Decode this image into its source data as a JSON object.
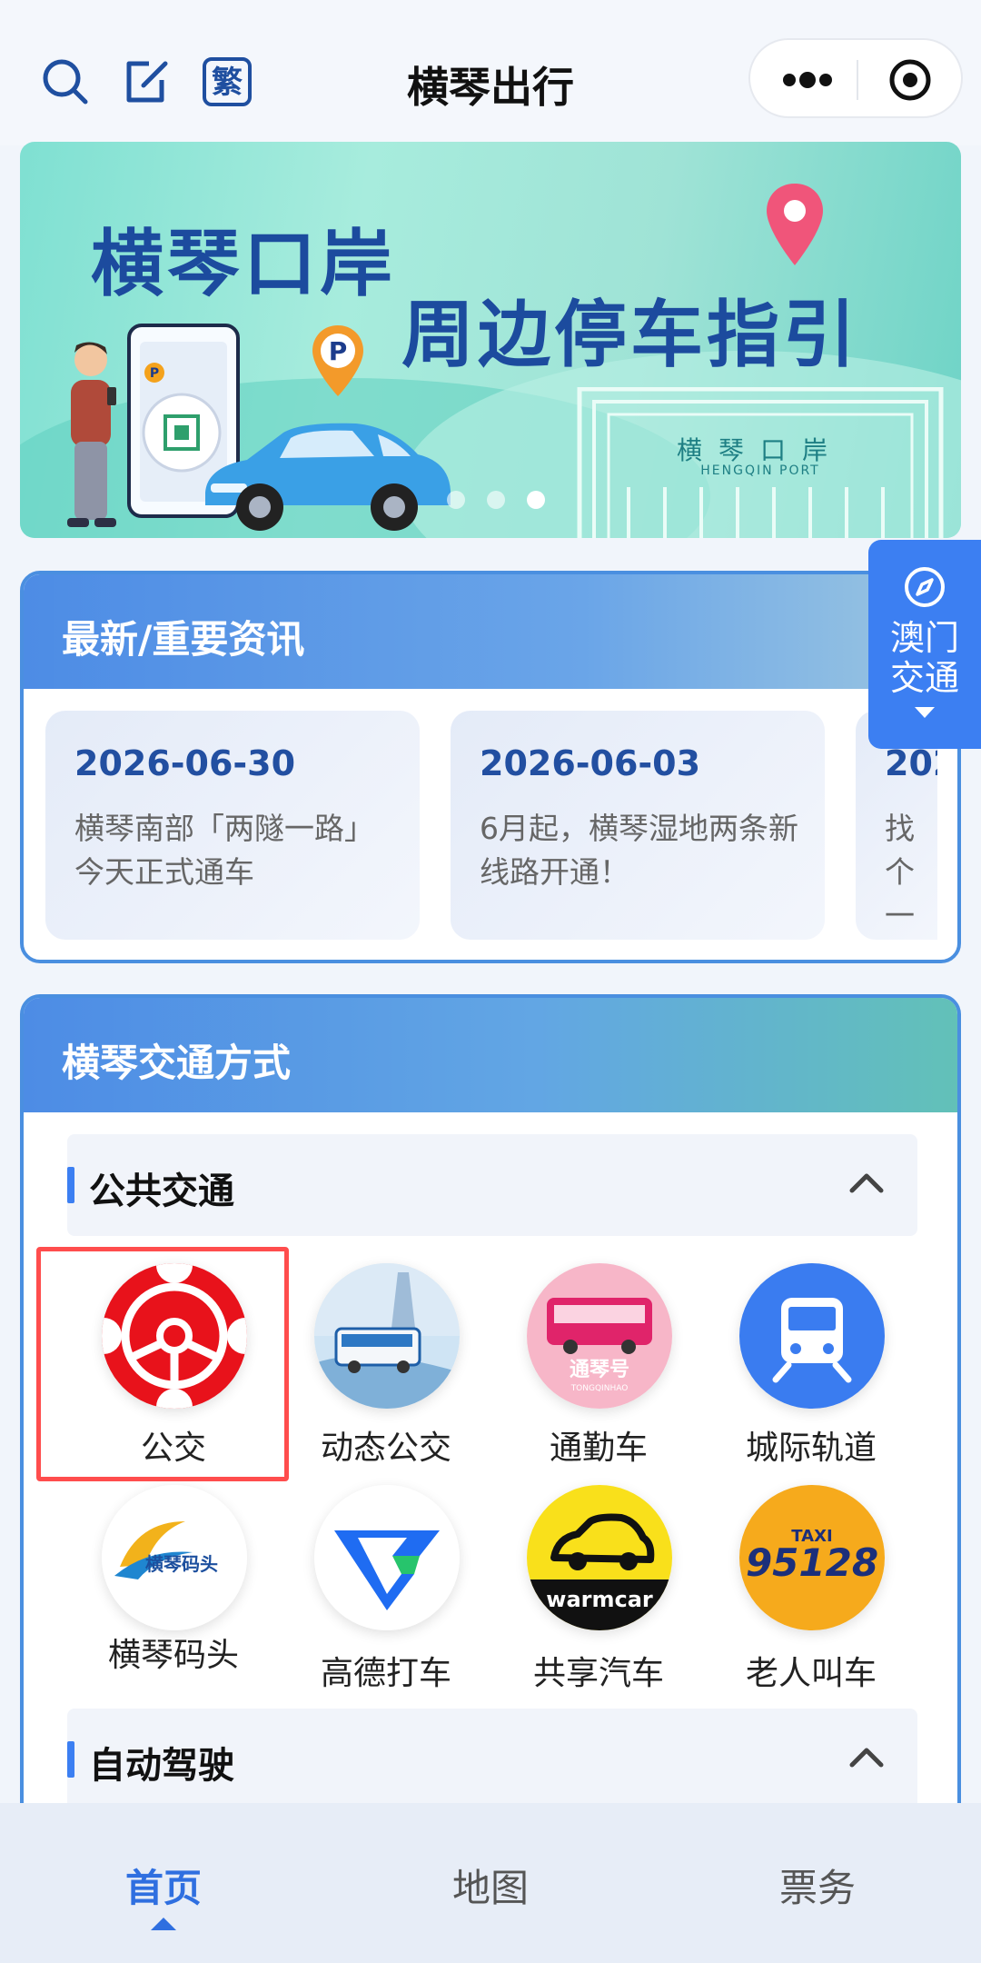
{
  "header": {
    "title": "横琴出行"
  },
  "banner": {
    "line1": "横琴口岸",
    "line2": "周边停车指引",
    "port_name": "横琴口岸",
    "port_sub": "HENGQIN PORT",
    "slides": 3,
    "active_slide": 3
  },
  "float_tab": {
    "label_line1": "澳门",
    "label_line2": "交通"
  },
  "news": {
    "title": "最新/重要资讯",
    "items": [
      {
        "date": "2026-06-30",
        "text": "横琴南部「两隧一路」今天正式通车"
      },
      {
        "date": "2026-06-03",
        "text": "6月起，横琴湿地两条新线路开通！"
      },
      {
        "date": "202",
        "text": "找个一"
      }
    ]
  },
  "transport": {
    "title": "横琴交通方式",
    "public": {
      "title": "公共交通",
      "items": [
        {
          "label": "公交",
          "icon": "bus-steering-wheel-icon"
        },
        {
          "label": "动态公交",
          "icon": "dynamic-bus-icon"
        },
        {
          "label": "通勤车",
          "icon": "commuter-bus-icon"
        },
        {
          "label": "城际轨道",
          "icon": "intercity-rail-icon"
        },
        {
          "label": "横琴码头",
          "icon": "hengqin-pier-icon"
        },
        {
          "label": "高德打车",
          "icon": "amap-taxi-icon"
        },
        {
          "label": "共享汽车",
          "icon": "warmcar-icon"
        },
        {
          "label": "老人叫车",
          "icon": "elderly-taxi-icon"
        }
      ]
    },
    "autonomous": {
      "title": "自动驾驶"
    }
  },
  "icon_text": {
    "commuter": "通琴号",
    "commuter_sub": "TONGQINHAO",
    "pier": "横琴码头",
    "warmcar": "warmcar",
    "taxi_top": "TAXI",
    "taxi_num": "95128"
  },
  "tabs": [
    {
      "label": "首页",
      "active": true
    },
    {
      "label": "地图",
      "active": false
    },
    {
      "label": "票务",
      "active": false
    }
  ],
  "colors": {
    "primary": "#3c7ff2",
    "highlight": "#ff4d4d",
    "bus_red": "#e8121b"
  }
}
